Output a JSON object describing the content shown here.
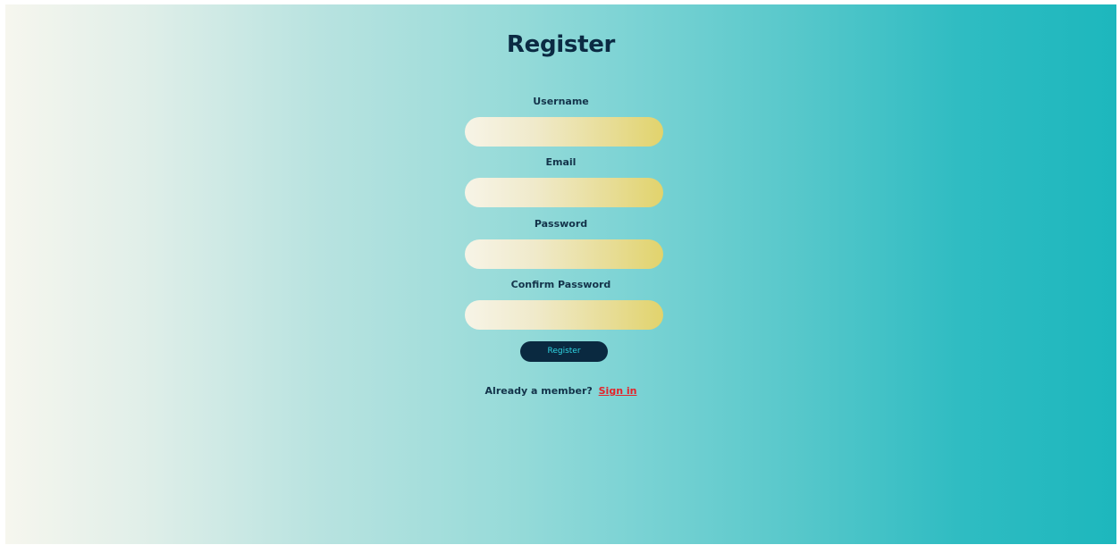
{
  "form": {
    "title": "Register",
    "fields": [
      {
        "label": "Username",
        "value": "",
        "placeholder": ""
      },
      {
        "label": "Email",
        "value": "",
        "placeholder": ""
      },
      {
        "label": "Password",
        "value": "",
        "placeholder": ""
      },
      {
        "label": "Confirm Password",
        "value": "",
        "placeholder": ""
      }
    ],
    "submit_label": "Register",
    "footer_text": "Already a member?",
    "signin_link": "Sign in"
  },
  "colors": {
    "heading": "#0b2a43",
    "button_bg": "#0a2940",
    "button_text": "#2fd6e4",
    "link": "#e3242b",
    "background_gradient": [
      "#f6f6ee",
      "#1db7bd"
    ],
    "field_gradient": [
      "#f7f4e7",
      "#e1d36c"
    ]
  }
}
